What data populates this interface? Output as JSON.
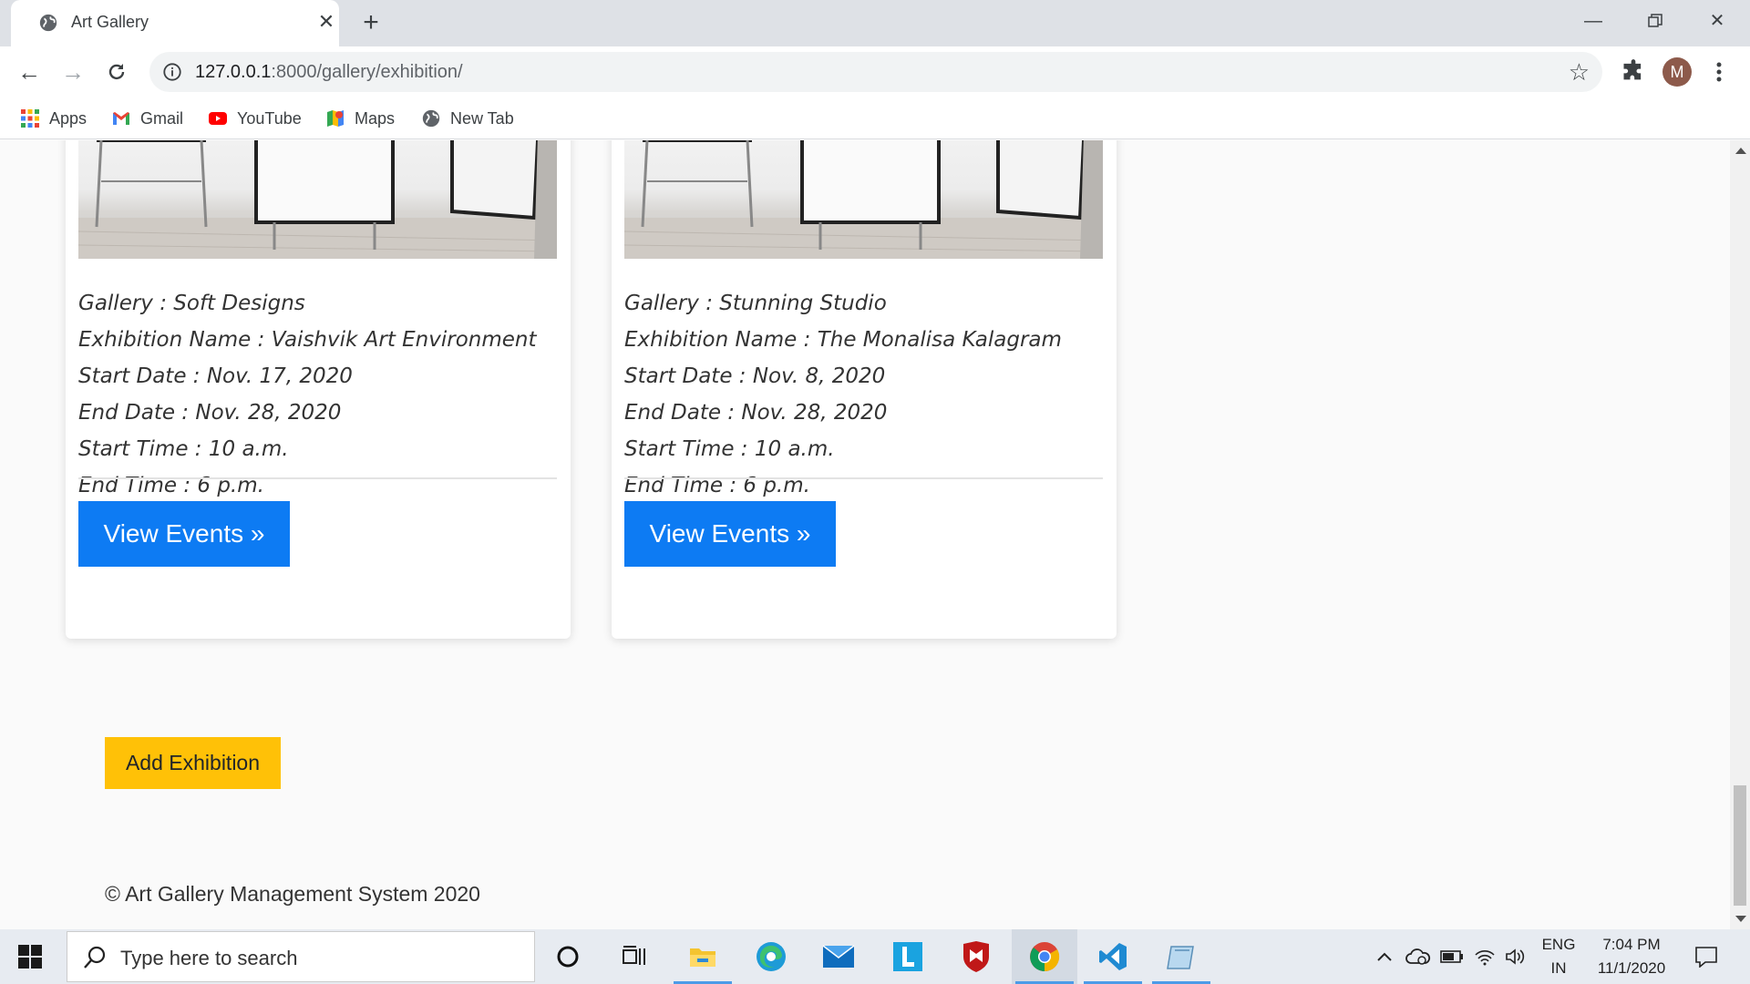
{
  "browser": {
    "tab_title": "Art Gallery",
    "url_host": "127.0.0.1",
    "url_path": ":8000/gallery/exhibition/",
    "avatar_initial": "M",
    "bookmarks": [
      {
        "label": "Apps",
        "icon": "apps-grid-icon"
      },
      {
        "label": "Gmail",
        "icon": "gmail-icon"
      },
      {
        "label": "YouTube",
        "icon": "youtube-icon"
      },
      {
        "label": "Maps",
        "icon": "maps-icon"
      },
      {
        "label": "New Tab",
        "icon": "globe-icon"
      }
    ]
  },
  "exhibitions": [
    {
      "gallery": "Gallery : Soft Designs",
      "name": "Exhibition Name : Vaishvik Art Environment",
      "start_date": "Start Date : Nov. 17, 2020",
      "end_date": "End Date : Nov. 28, 2020",
      "start_time": "Start Time : 10 a.m.",
      "end_time": "End Time : 6 p.m.",
      "button": "View Events »"
    },
    {
      "gallery": "Gallery : Stunning Studio",
      "name": "Exhibition Name : The Monalisa Kalagram",
      "start_date": "Start Date : Nov. 8, 2020",
      "end_date": "End Date : Nov. 28, 2020",
      "start_time": "Start Time : 10 a.m.",
      "end_time": "End Time : 6 p.m.",
      "button": "View Events »"
    }
  ],
  "add_button": "Add Exhibition",
  "footer": "© Art Gallery Management System 2020",
  "colors": {
    "primary": "#0d7bf3",
    "warning": "#ffc107"
  },
  "taskbar": {
    "search_placeholder": "Type here to search",
    "lang_top": "ENG",
    "lang_bottom": "IN",
    "time": "7:04 PM",
    "date": "11/1/2020"
  }
}
